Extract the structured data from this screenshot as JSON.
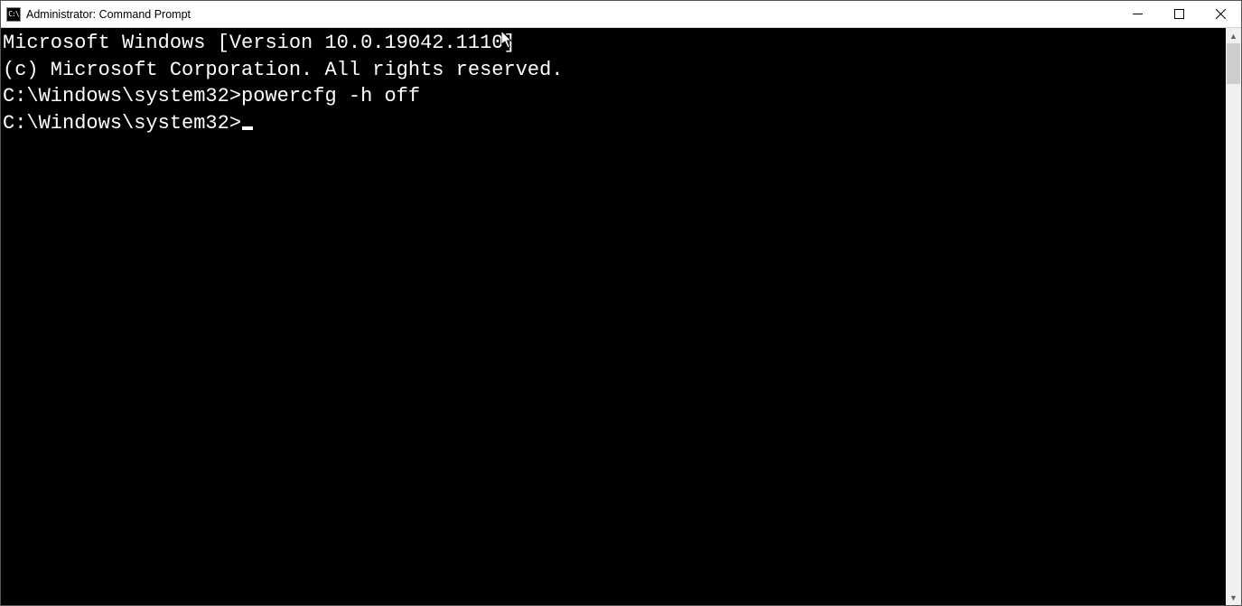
{
  "window": {
    "title": "Administrator: Command Prompt",
    "icon_label": "C:\\"
  },
  "terminal": {
    "line1": "Microsoft Windows [Version 10.0.19042.1110]",
    "line2": "(c) Microsoft Corporation. All rights reserved.",
    "blank1": "",
    "prompt1_prefix": "C:\\Windows\\system32>",
    "prompt1_command": "powercfg -h off",
    "blank2": "",
    "prompt2_prefix": "C:\\Windows\\system32>"
  }
}
